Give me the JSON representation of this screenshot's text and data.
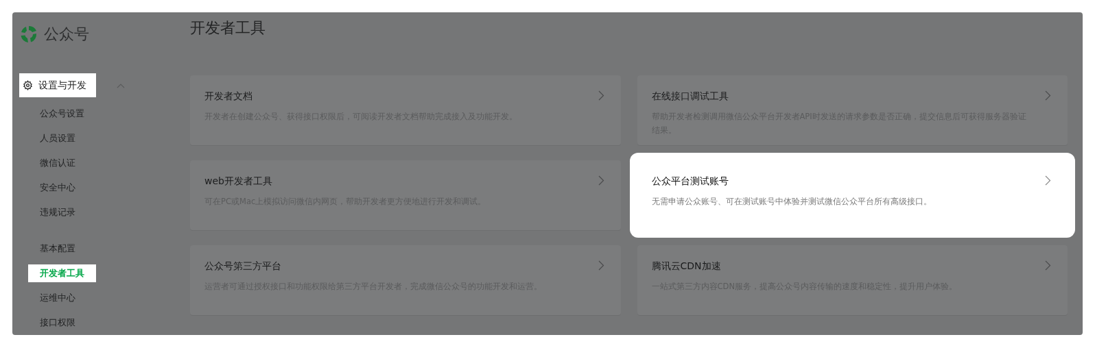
{
  "logo": {
    "text": "公众号"
  },
  "page_title": "开发者工具",
  "sidebar": {
    "section": {
      "label": "设置与开发",
      "highlighted": true,
      "expanded": true
    },
    "groups": [
      {
        "items": [
          {
            "label": "公众号设置",
            "selected": false
          },
          {
            "label": "人员设置",
            "selected": false
          },
          {
            "label": "微信认证",
            "selected": false
          },
          {
            "label": "安全中心",
            "selected": false
          },
          {
            "label": "违规记录",
            "selected": false
          }
        ]
      },
      {
        "items": [
          {
            "label": "基本配置",
            "selected": false
          },
          {
            "label": "开发者工具",
            "selected": true
          },
          {
            "label": "运维中心",
            "selected": false
          },
          {
            "label": "接口权限",
            "selected": false
          }
        ]
      }
    ]
  },
  "cards": [
    {
      "title": "开发者文档",
      "description": "开发者在创建公众号、获得接口权限后，可阅读开发者文档帮助完成接入及功能开发。",
      "highlighted": false
    },
    {
      "title": "在线接口调试工具",
      "description": "帮助开发者检测调用微信公众平台开发者API时发送的请求参数是否正确，提交信息后可获得服务器验证结果。",
      "highlighted": false
    },
    {
      "title": "web开发者工具",
      "description": "可在PC或Mac上模拟访问微信内网页，帮助开发者更方便地进行开发和调试。",
      "highlighted": false
    },
    {
      "title": "公众平台测试账号",
      "description": "无需申请公众账号、可在测试账号中体验并测试微信公众平台所有高级接口。",
      "highlighted": true
    },
    {
      "title": "公众号第三方平台",
      "description": "运营者可通过授权接口和功能权限给第三方平台开发者，完成微信公众号的功能开发和运营。",
      "highlighted": false
    },
    {
      "title": "腾讯云CDN加速",
      "description": "一站式第三方内容CDN服务，提高公众号内容传输的速度和稳定性，提升用户体验。",
      "highlighted": false
    }
  ]
}
